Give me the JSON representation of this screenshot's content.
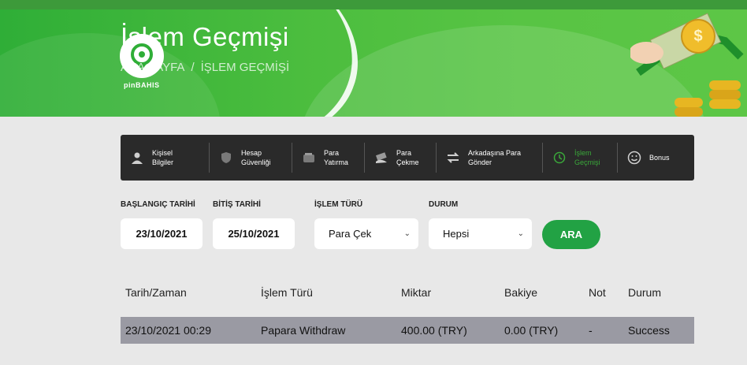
{
  "hero": {
    "title": "İşlem Geçmişi",
    "breadcrumb_home": "ANA SAYFA",
    "breadcrumb_sep": "/",
    "breadcrumb_current": "İŞLEM GEÇMİŞİ",
    "logo_text": "pinBAHIS"
  },
  "nav": {
    "items": [
      {
        "line1": "Kişisel",
        "line2": "Bilgiler",
        "icon": "user-icon"
      },
      {
        "line1": "Hesap",
        "line2": "Güvenliği",
        "icon": "shield-icon"
      },
      {
        "line1": "Para",
        "line2": "Yatırma",
        "icon": "wallet-icon"
      },
      {
        "line1": "Para",
        "line2": "Çekme",
        "icon": "cash-withdraw-icon"
      },
      {
        "line1": "Arkadaşına Para",
        "line2": "Gönder",
        "icon": "transfer-icon"
      },
      {
        "line1": "İşlem",
        "line2": "Geçmişi",
        "icon": "history-icon"
      },
      {
        "line1": "Bonus",
        "line2": "",
        "icon": "smile-icon"
      }
    ],
    "active_color": "#3aa83a"
  },
  "filters": {
    "start_label": "BAŞLANGIÇ TARİHİ",
    "start_value": "23/10/2021",
    "end_label": "BİTİŞ TARİHİ",
    "end_value": "25/10/2021",
    "type_label": "İŞLEM TÜRÜ",
    "type_value": "Para Çek",
    "status_label": "DURUM",
    "status_value": "Hepsi",
    "search_label": "ARA"
  },
  "table": {
    "headers": [
      "Tarih/Zaman",
      "İşlem Türü",
      "Miktar",
      "Bakiye",
      "Not",
      "Durum"
    ],
    "rows": [
      [
        "23/10/2021 00:29",
        "Papara Withdraw",
        "400.00 (TRY)",
        "0.00 (TRY)",
        "-",
        "Success"
      ]
    ]
  },
  "colors": {
    "accent": "#22a244",
    "nav_bg": "#2a2a2a",
    "row_bg": "#9a9aa3"
  }
}
